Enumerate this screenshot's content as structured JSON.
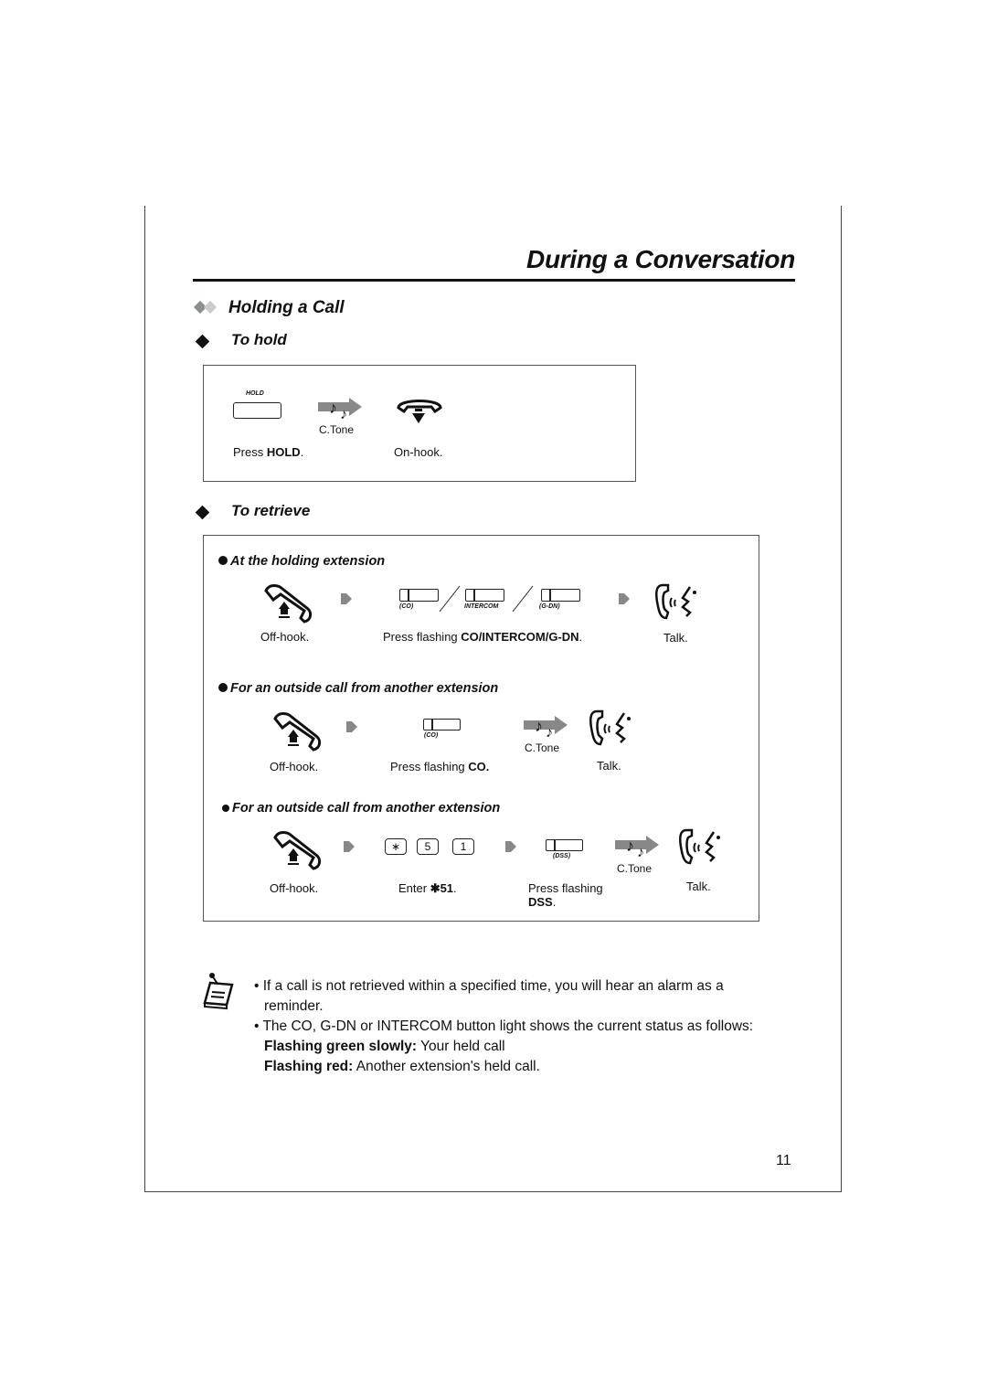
{
  "page": {
    "title": "During a Conversation",
    "number": "11"
  },
  "section": {
    "title": "Holding a Call"
  },
  "to_hold": {
    "title": "To hold",
    "steps": [
      {
        "button_label": "HOLD",
        "caption_prefix": "Press ",
        "caption_bold": "HOLD",
        "caption_suffix": "."
      },
      {
        "tone_label": "C.Tone"
      },
      {
        "caption": "On-hook."
      }
    ]
  },
  "to_retrieve": {
    "title": "To retrieve",
    "cases": [
      {
        "heading": "At the holding extension",
        "offhook": "Off-hook.",
        "buttons": [
          "(CO)",
          "INTERCOM",
          "(G-DN)"
        ],
        "press_prefix": "Press flashing ",
        "press_bold": "CO/INTERCOM/G-DN",
        "press_suffix": ".",
        "talk": "Talk."
      },
      {
        "heading": "For an outside call from another extension",
        "offhook": "Off-hook.",
        "button": "(CO)",
        "press_prefix": "Press flashing ",
        "press_bold": "CO.",
        "tone": "C.Tone",
        "talk": "Talk."
      },
      {
        "heading": "For an outside call from another extension",
        "offhook": "Off-hook.",
        "keys": [
          "∗",
          "5",
          "1"
        ],
        "enter_prefix": "Enter ",
        "enter_bold": "✱51",
        "enter_suffix": ".",
        "button": "(DSS)",
        "press_line1": "Press flashing",
        "press_bold": "DSS",
        "press_suffix": ".",
        "tone": "C.Tone",
        "talk": "Talk."
      }
    ]
  },
  "notes": {
    "bullet1": "If a call is not retrieved within a specified time, you will hear an alarm as a",
    "bullet1_cont": "reminder.",
    "bullet2": "The CO, G-DN or INTERCOM button light shows the current status as follows:",
    "line_green_label": "Flashing green slowly:",
    "line_green_text": " Your held call",
    "line_red_label": "Flashing red:",
    "line_red_text": " Another extension's held call."
  }
}
